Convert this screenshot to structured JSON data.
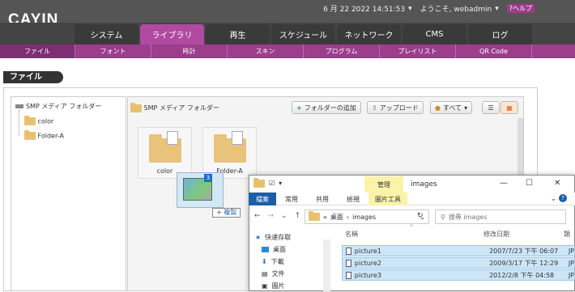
{
  "topbar": {
    "datetime": "6 月 22 2022 14:51:53",
    "welcome": "ようこそ, webadmin",
    "help": "ヘルプ"
  },
  "logo": "CAYIN",
  "nav": [
    {
      "label": "システム"
    },
    {
      "label": "ライブラリ"
    },
    {
      "label": "再生"
    },
    {
      "label": "スケジュール"
    },
    {
      "label": "ネットワーク"
    },
    {
      "label": "CMS"
    },
    {
      "label": "ログ"
    }
  ],
  "subnav": [
    {
      "label": "ファイル"
    },
    {
      "label": "フォント"
    },
    {
      "label": "時計"
    },
    {
      "label": "スキン"
    },
    {
      "label": "プログラム"
    },
    {
      "label": "プレイリスト"
    },
    {
      "label": "QR Code"
    }
  ],
  "page_title": "ファイル",
  "tree": {
    "root": "SMP メディア フォルダー",
    "children": [
      "color",
      "Folder-A"
    ]
  },
  "filepane": {
    "path": "SMP メディア フォルダー",
    "add_folder": "フォルダーの追加",
    "upload": "アップロード",
    "filter": "すべて",
    "folders": [
      "color",
      "Folder-A"
    ]
  },
  "drag": {
    "count": "3",
    "copy": "+ 複製"
  },
  "explorer": {
    "manage": "管理",
    "title": "images",
    "ribbon": [
      "檔案",
      "常用",
      "共用",
      "檢視",
      "圖片工具"
    ],
    "address": [
      "桌面",
      "images"
    ],
    "search_placeholder": "搜尋 images",
    "nav": [
      "快速存取",
      "桌面",
      "下載",
      "文件",
      "圖片"
    ],
    "col_name": "名稱",
    "col_date": "修改日期",
    "files": [
      {
        "name": "picture1",
        "date": "2007/7/23 下午 06:07"
      },
      {
        "name": "picture2",
        "date": "2009/3/17 下午 12:29"
      },
      {
        "name": "picture3",
        "date": "2012/2/8 下午 04:58"
      }
    ],
    "col_type_partial": "類",
    "types": [
      "JP",
      "JP",
      "JP"
    ]
  }
}
